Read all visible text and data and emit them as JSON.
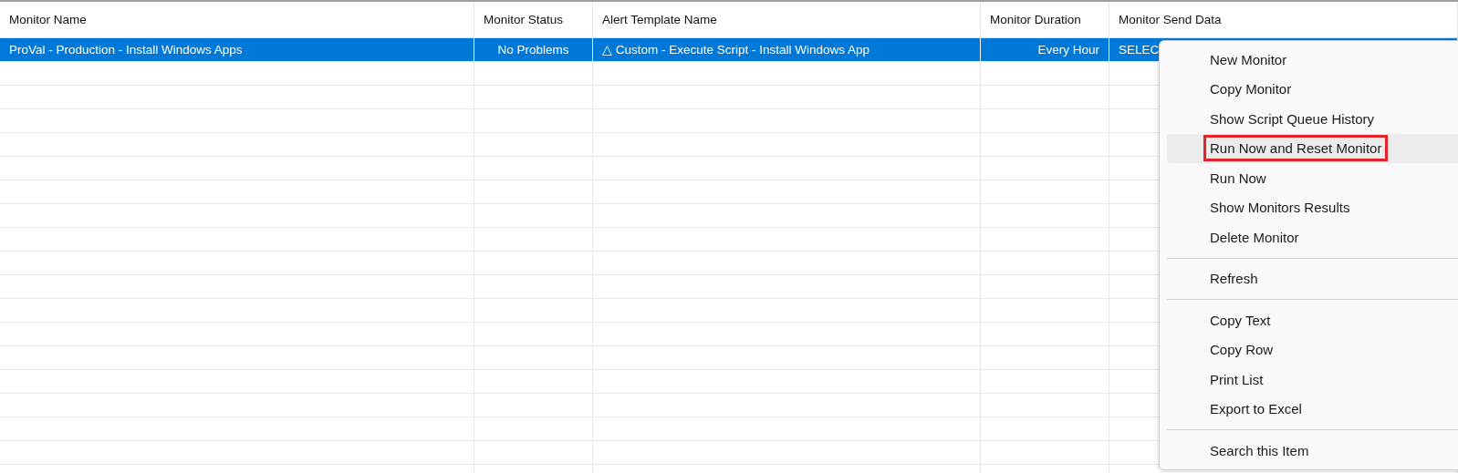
{
  "table": {
    "columns": [
      {
        "label": "Monitor Name"
      },
      {
        "label": "Monitor Status"
      },
      {
        "label": "Alert Template Name"
      },
      {
        "label": "Monitor Duration"
      },
      {
        "label": "Monitor Send Data"
      }
    ],
    "rows": [
      {
        "selected": true,
        "cells": [
          "ProVal - Production - Install Windows Apps",
          "No Problems",
          "△ Custom - Execute Script - Install Windows App",
          "Every Hour",
          "SELEC"
        ]
      }
    ]
  },
  "context_menu": {
    "items": [
      {
        "kind": "item",
        "label": "New Monitor",
        "highlighted": false,
        "outlined": false
      },
      {
        "kind": "item",
        "label": "Copy Monitor",
        "highlighted": false,
        "outlined": false
      },
      {
        "kind": "item",
        "label": "Show Script Queue History",
        "highlighted": false,
        "outlined": false
      },
      {
        "kind": "item",
        "label": "Run Now and Reset Monitor",
        "highlighted": true,
        "outlined": true
      },
      {
        "kind": "item",
        "label": "Run Now",
        "highlighted": false,
        "outlined": false
      },
      {
        "kind": "item",
        "label": "Show Monitors Results",
        "highlighted": false,
        "outlined": false
      },
      {
        "kind": "item",
        "label": "Delete Monitor",
        "highlighted": false,
        "outlined": false
      },
      {
        "kind": "separator"
      },
      {
        "kind": "item",
        "label": "Refresh",
        "highlighted": false,
        "outlined": false
      },
      {
        "kind": "separator"
      },
      {
        "kind": "item",
        "label": "Copy Text",
        "highlighted": false,
        "outlined": false
      },
      {
        "kind": "item",
        "label": "Copy Row",
        "highlighted": false,
        "outlined": false
      },
      {
        "kind": "item",
        "label": "Print List",
        "highlighted": false,
        "outlined": false
      },
      {
        "kind": "item",
        "label": "Export to Excel",
        "highlighted": false,
        "outlined": false
      },
      {
        "kind": "separator"
      },
      {
        "kind": "item",
        "label": "Search this Item",
        "highlighted": false,
        "outlined": false
      }
    ]
  }
}
